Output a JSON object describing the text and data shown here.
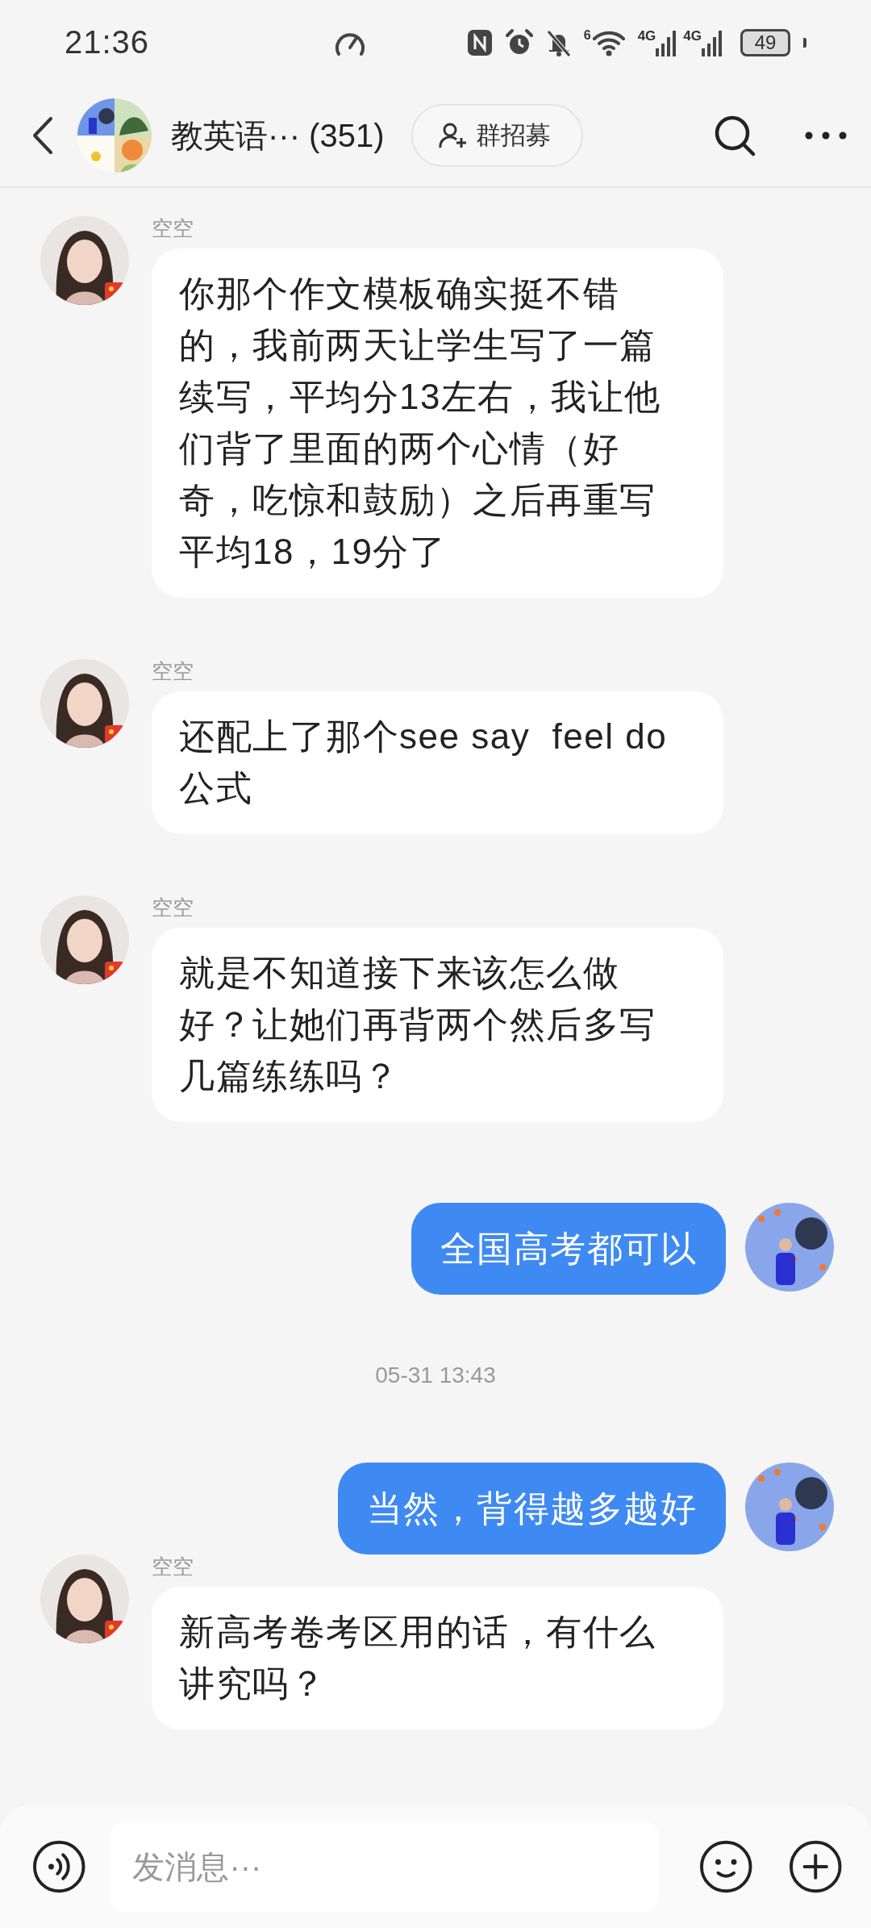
{
  "status_bar": {
    "time": "21:36",
    "wifi_label": "6",
    "network_labels": [
      "4G",
      "4G"
    ],
    "battery": "49"
  },
  "header": {
    "title": "教英语··· (351)",
    "recruit_button": "群招募"
  },
  "messages": [
    {
      "kind": "incoming",
      "sender": "空空",
      "text": "你那个作文模板确实挺不错的，我前两天让学生写了一篇续写，平均分13左右，我让他们背了里面的两个心情（好奇，吃惊和鼓励）之后再重写平均18，19分了"
    },
    {
      "kind": "incoming",
      "sender": "空空",
      "text": "还配上了那个see say  feel do 公式"
    },
    {
      "kind": "incoming",
      "sender": "空空",
      "text": "就是不知道接下来该怎么做好？让她们再背两个然后多写几篇练练吗？"
    },
    {
      "kind": "outgoing",
      "text": "全国高考都可以"
    },
    {
      "kind": "timestamp",
      "text": "05-31 13:43"
    },
    {
      "kind": "outgoing",
      "text": "当然，背得越多越好"
    },
    {
      "kind": "incoming",
      "sender": "空空",
      "text": "新高考卷考区用的话，有什么讲究吗？"
    }
  ],
  "composer": {
    "placeholder": "发消息···"
  }
}
